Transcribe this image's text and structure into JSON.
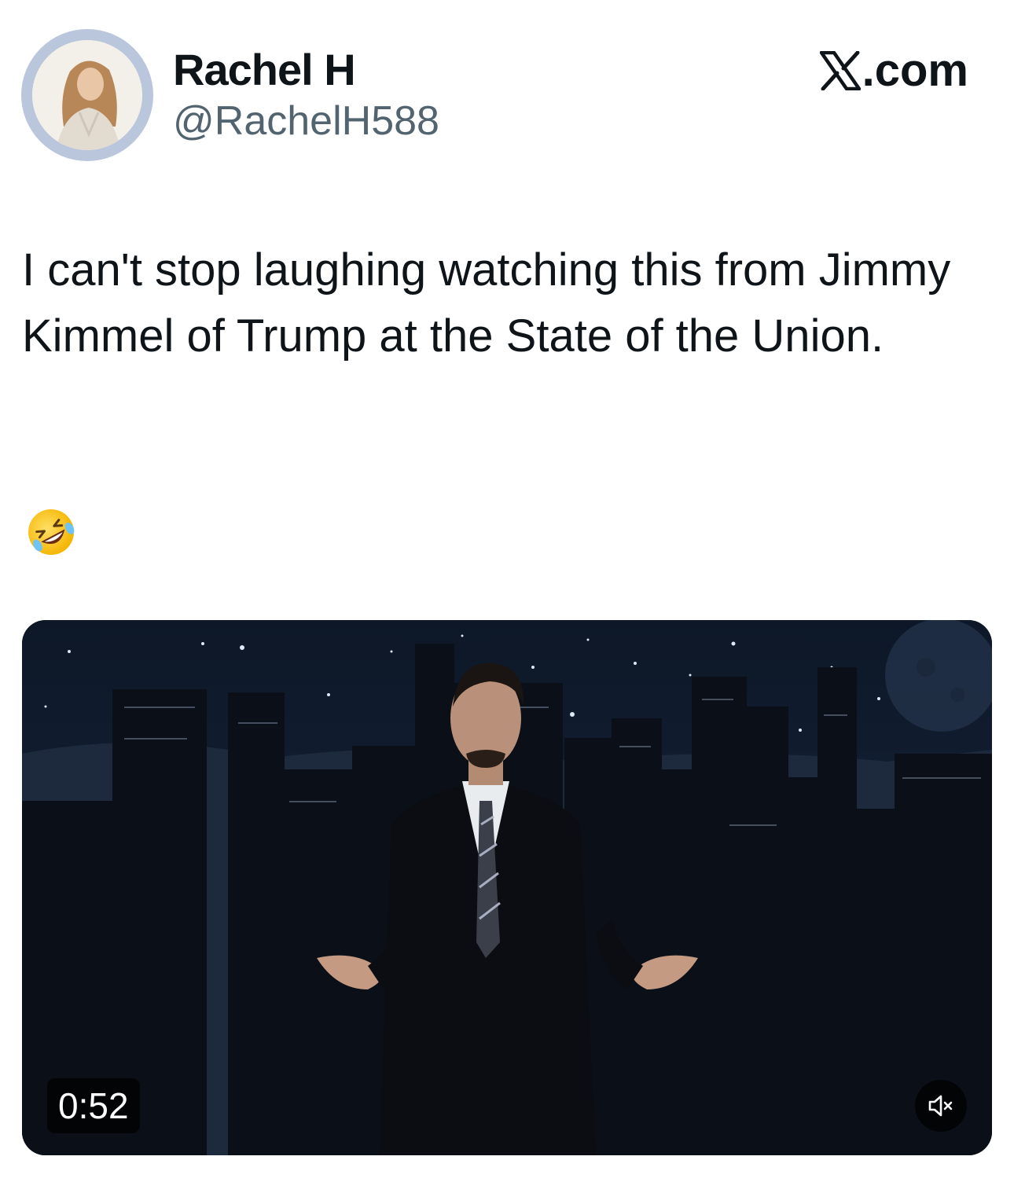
{
  "author": {
    "display_name": "Rachel H",
    "handle": "@RachelH588"
  },
  "brand": {
    "suffix": ".com",
    "icon": "x-logo-icon"
  },
  "tweet": {
    "text": "I can't stop laughing watching this from Jimmy Kimmel of Trump at the State of the Union.",
    "emoji_icon": "rolling-on-floor-laughing-icon"
  },
  "video": {
    "duration": "0:52",
    "mute_icon": "speaker-muted-icon"
  },
  "colors": {
    "text": "#0f1419",
    "secondary": "#536471",
    "avatar_ring": "#b9c6dc",
    "video_bg": "#0c1320"
  }
}
